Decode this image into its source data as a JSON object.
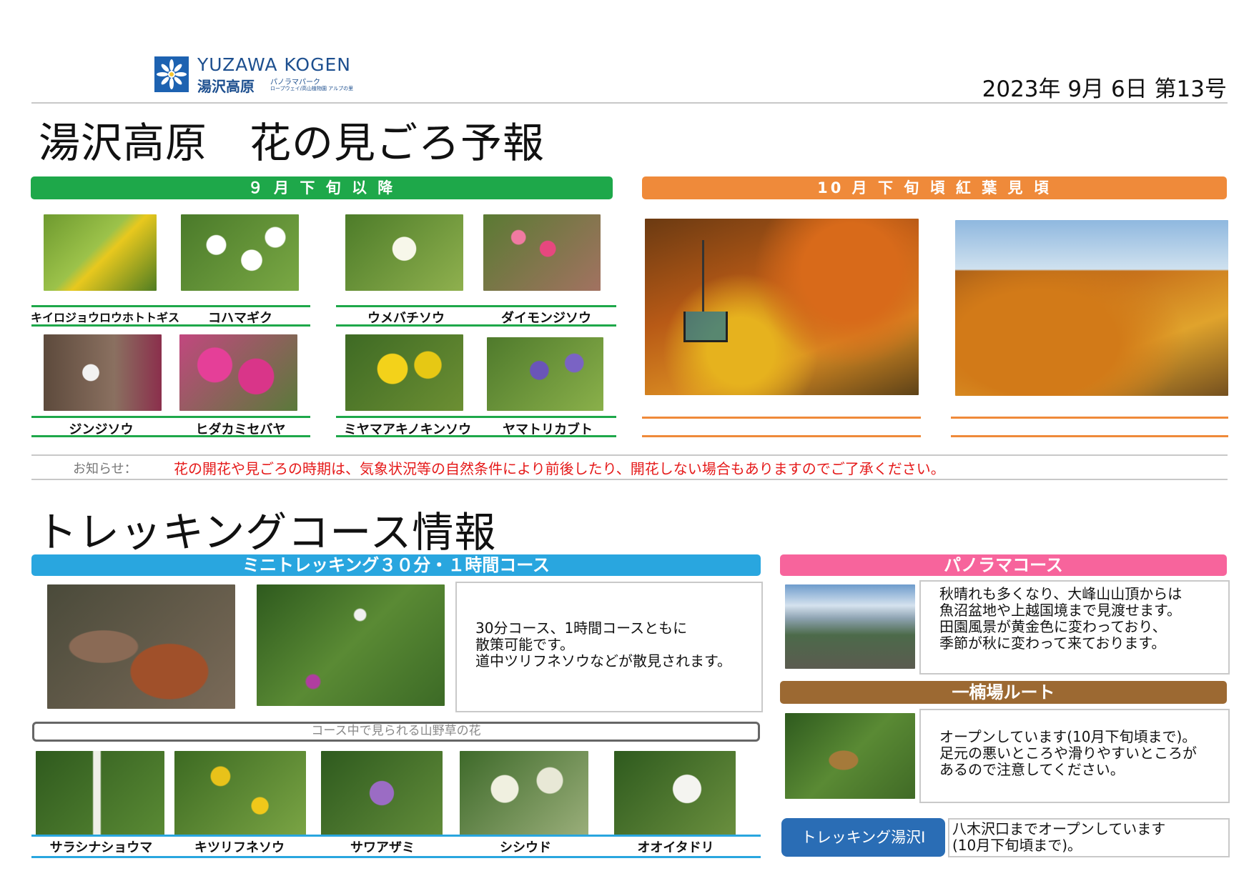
{
  "header": {
    "logo_en": "YUZAWA KOGEN",
    "logo_jp": "湯沢高原",
    "logo_sub1": "パノラマパーク",
    "logo_sub2": "ロープウェイ/高山植物園 アルプの里",
    "issue": "2023年  9月  6日   第13号"
  },
  "flowers": {
    "title": "湯沢高原　花の見ごろ予報",
    "band_sept": "９ 月 下 旬 以 降",
    "band_oct": "10 月 下 旬 頃 紅 葉 見 頃",
    "row1": [
      "キイロジョウロウホトトギス",
      "コハマギク",
      "ウメバチソウ",
      "ダイモンジソウ"
    ],
    "row2": [
      "ジンジソウ",
      "ヒダカミセバヤ",
      "ミヤマアキノキンソウ",
      "ヤマトリカブト"
    ],
    "notice_label": "お知らせ：",
    "notice": "花の開花や見ごろの時期は、気象状況等の自然条件により前後したり、開花しない場合もありますのでご了承ください。"
  },
  "trekking": {
    "title": "トレッキングコース情報",
    "mini_band": "ミニトレッキング３０分・１時間コース",
    "mini_text": "30分コース、1時間コースともに\n散策可能です。\n道中ツリフネソウなどが散見されます。",
    "caption": "コース中で見られる山野草の花",
    "flowers": [
      "サラシナショウマ",
      "キツリフネソウ",
      "サワアザミ",
      "シシウド",
      "オオイタドリ"
    ],
    "panorama_band": "パノラマコース",
    "panorama_text": "秋晴れも多くなり、大峰山山頂からは\n魚沼盆地や上越国境まで見渡せます。\n田園風景が黄金色に変わっており、\n季節が秋に変わって来ております。",
    "ichi_band": "一楠場ルート",
    "ichi_text": "オープンしています(10月下旬頃まで)。\n足元の悪いところや滑りやすいところが\nあるので注意してください。",
    "yuzawa_btn": "トレッキング湯沢Ⅰ",
    "yuzawa_text": "八木沢口までオープンしています\n(10月下旬頃まで)。"
  },
  "colors": {
    "green": "#1ea84a",
    "orange": "#ef8a3a",
    "blue": "#29a6df",
    "pink": "#f7649c",
    "brown": "#9c6932",
    "navy": "#2a6db5",
    "notice_red": "#e51a1a"
  }
}
